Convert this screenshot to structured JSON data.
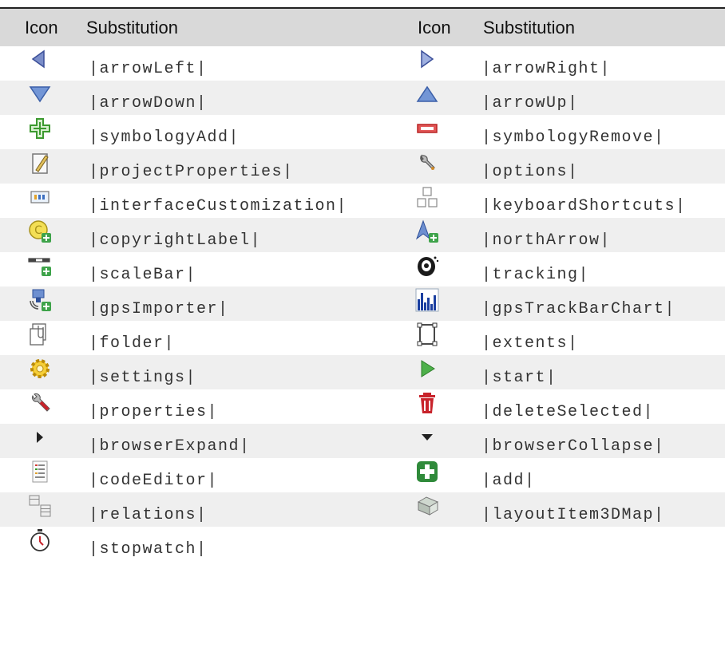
{
  "headers": {
    "icon_left": "Icon",
    "subst_left": "Substitution",
    "icon_right": "Icon",
    "subst_right": "Substitution"
  },
  "rows": [
    {
      "left": {
        "icon": "arrow-left-icon",
        "code": "|arrowLeft|"
      },
      "right": {
        "icon": "arrow-right-icon",
        "code": "|arrowRight|"
      }
    },
    {
      "left": {
        "icon": "arrow-down-icon",
        "code": "|arrowDown|"
      },
      "right": {
        "icon": "arrow-up-icon",
        "code": "|arrowUp|"
      }
    },
    {
      "left": {
        "icon": "symbology-add-icon",
        "code": "|symbologyAdd|"
      },
      "right": {
        "icon": "symbology-remove-icon",
        "code": "|symbologyRemove|"
      }
    },
    {
      "left": {
        "icon": "project-properties-icon",
        "code": "|projectProperties|"
      },
      "right": {
        "icon": "options-icon",
        "code": "|options|"
      }
    },
    {
      "left": {
        "icon": "interface-customization-icon",
        "code": "|interfaceCustomization|"
      },
      "right": {
        "icon": "keyboard-shortcuts-icon",
        "code": "|keyboardShortcuts|"
      }
    },
    {
      "left": {
        "icon": "copyright-label-icon",
        "code": "|copyrightLabel|"
      },
      "right": {
        "icon": "north-arrow-icon",
        "code": "|northArrow|"
      }
    },
    {
      "left": {
        "icon": "scale-bar-icon",
        "code": "|scaleBar|"
      },
      "right": {
        "icon": "tracking-icon",
        "code": "|tracking|"
      }
    },
    {
      "left": {
        "icon": "gps-importer-icon",
        "code": "|gpsImporter|"
      },
      "right": {
        "icon": "gps-track-bar-chart-icon",
        "code": "|gpsTrackBarChart|"
      }
    },
    {
      "left": {
        "icon": "folder-icon",
        "code": "|folder|"
      },
      "right": {
        "icon": "extents-icon",
        "code": "|extents|"
      }
    },
    {
      "left": {
        "icon": "settings-icon",
        "code": "|settings|"
      },
      "right": {
        "icon": "start-icon",
        "code": "|start|"
      }
    },
    {
      "left": {
        "icon": "properties-icon",
        "code": "|properties|"
      },
      "right": {
        "icon": "delete-selected-icon",
        "code": "|deleteSelected|"
      }
    },
    {
      "left": {
        "icon": "browser-expand-icon",
        "code": "|browserExpand|"
      },
      "right": {
        "icon": "browser-collapse-icon",
        "code": "|browserCollapse|"
      }
    },
    {
      "left": {
        "icon": "code-editor-icon",
        "code": "|codeEditor|"
      },
      "right": {
        "icon": "add-icon",
        "code": "|add|"
      }
    },
    {
      "left": {
        "icon": "relations-icon",
        "code": "|relations|"
      },
      "right": {
        "icon": "layout-item-3d-map-icon",
        "code": "|layoutItem3DMap|"
      }
    },
    {
      "left": {
        "icon": "stopwatch-icon",
        "code": "|stopwatch|"
      },
      "right": null
    }
  ],
  "colors": {
    "header_bg": "#d9d9d9",
    "alt_row_bg": "#efefef",
    "text": "#333333"
  }
}
